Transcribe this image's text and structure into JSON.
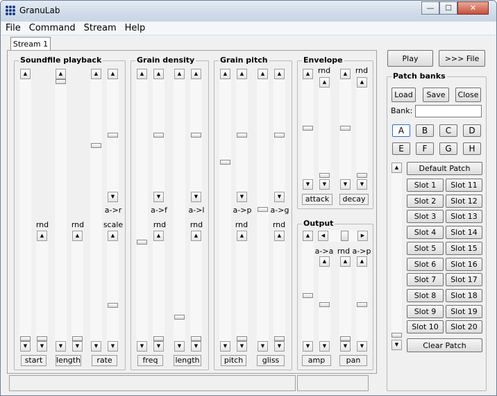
{
  "window": {
    "title": "GranuLab",
    "minimize": "—",
    "maximize": "☐",
    "close": "✕"
  },
  "menu": [
    "File",
    "Command",
    "Stream",
    "Help"
  ],
  "tab": "Stream 1",
  "groups": {
    "playback": "Soundfile playback",
    "density": "Grain density",
    "pitch": "Grain pitch",
    "envelope": "Envelope",
    "output": "Output"
  },
  "playback": {
    "rnd1": "rnd",
    "rnd2": "rnd",
    "scale": "scale",
    "a_r": "a->r",
    "start": "start",
    "length": "length",
    "rate": "rate"
  },
  "density": {
    "rnd1": "rnd",
    "rnd2": "rnd",
    "a_f": "a->f",
    "a_l": "a->l",
    "freq": "freq",
    "length": "length"
  },
  "pitch": {
    "rnd1": "rnd",
    "rnd2": "rnd",
    "a_p": "a->p",
    "a_g": "a->g",
    "pitch": "pitch",
    "gliss": "gliss"
  },
  "envelope": {
    "rnd1": "rnd",
    "rnd2": "rnd",
    "attack": "attack",
    "decay": "decay"
  },
  "output": {
    "a_a": "a->a",
    "rnd": "rnd",
    "a_p": "a->p",
    "amp": "amp",
    "pan": "pan"
  },
  "controls": {
    "play": "Play",
    "to_file": ">>> File"
  },
  "patch_banks": {
    "title": "Patch banks",
    "load": "Load",
    "save": "Save",
    "close": "Close",
    "bank_label": "Bank:",
    "bank_value": "",
    "banks": [
      "A",
      "B",
      "C",
      "D",
      "E",
      "F",
      "G",
      "H"
    ],
    "default_patch": "Default Patch",
    "slots_left": [
      "Slot 1",
      "Slot 2",
      "Slot 3",
      "Slot 4",
      "Slot 5",
      "Slot 6",
      "Slot 7",
      "Slot 8",
      "Slot 9",
      "Slot 10"
    ],
    "slots_right": [
      "Slot 11",
      "Slot 12",
      "Slot 13",
      "Slot 14",
      "Slot 15",
      "Slot 16",
      "Slot 17",
      "Slot 18",
      "Slot 19",
      "Slot 20"
    ],
    "clear_patch": "Clear Patch"
  }
}
